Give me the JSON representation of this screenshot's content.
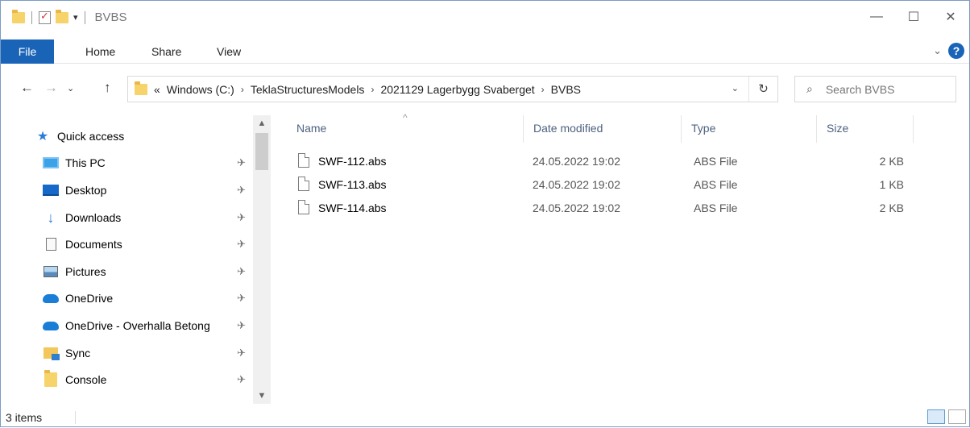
{
  "window": {
    "title": "BVBS"
  },
  "ribbon": {
    "tabs": [
      "File",
      "Home",
      "Share",
      "View"
    ]
  },
  "address": {
    "crumbs": [
      "Windows (C:)",
      "TeklaStructuresModels",
      "2021129 Lagerbygg Svaberget",
      "BVBS"
    ],
    "overflow": "«"
  },
  "search": {
    "placeholder": "Search BVBS"
  },
  "sidebar": {
    "items": [
      {
        "label": "Quick access",
        "icon": "star-icon",
        "pinned": false
      },
      {
        "label": "This PC",
        "icon": "computer-icon",
        "pinned": true
      },
      {
        "label": "Desktop",
        "icon": "desktop-icon",
        "pinned": true
      },
      {
        "label": "Downloads",
        "icon": "download-icon",
        "pinned": true
      },
      {
        "label": "Documents",
        "icon": "document-icon",
        "pinned": true
      },
      {
        "label": "Pictures",
        "icon": "pictures-icon",
        "pinned": true
      },
      {
        "label": "OneDrive",
        "icon": "cloud-icon",
        "pinned": true
      },
      {
        "label": "OneDrive - Overhalla Betong",
        "icon": "cloud-icon",
        "pinned": true
      },
      {
        "label": "Sync",
        "icon": "sync-folder-icon",
        "pinned": true
      },
      {
        "label": "Console",
        "icon": "folder-icon",
        "pinned": true
      }
    ]
  },
  "files": {
    "columns": {
      "name": "Name",
      "date": "Date modified",
      "type": "Type",
      "size": "Size"
    },
    "rows": [
      {
        "name": "SWF-112.abs",
        "date": "24.05.2022 19:02",
        "type": "ABS File",
        "size": "2 KB"
      },
      {
        "name": "SWF-113.abs",
        "date": "24.05.2022 19:02",
        "type": "ABS File",
        "size": "1 KB"
      },
      {
        "name": "SWF-114.abs",
        "date": "24.05.2022 19:02",
        "type": "ABS File",
        "size": "2 KB"
      }
    ]
  },
  "status": {
    "count": "3 items"
  },
  "colors": {
    "accent": "#1a64b8",
    "header_text": "#4d6180"
  }
}
